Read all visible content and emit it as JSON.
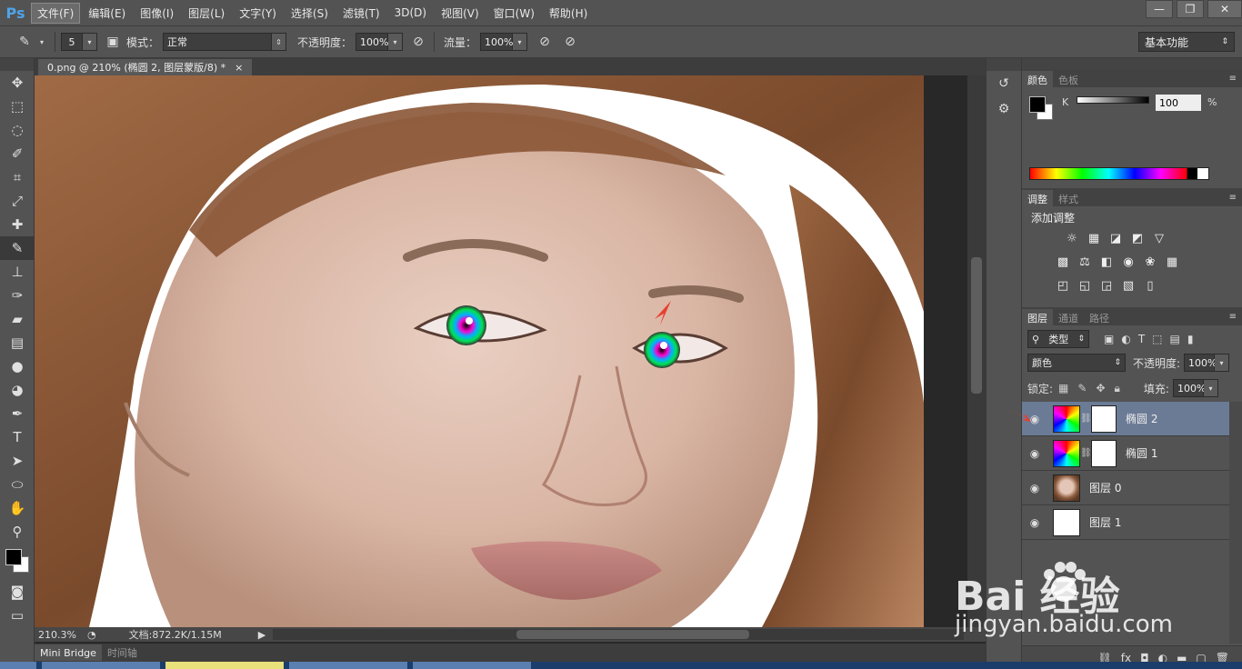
{
  "app": {
    "logo": "Ps",
    "accent": "#4fa3e8"
  },
  "menu": [
    "文件(F)",
    "编辑(E)",
    "图像(I)",
    "图层(L)",
    "文字(Y)",
    "选择(S)",
    "滤镜(T)",
    "3D(D)",
    "视图(V)",
    "窗口(W)",
    "帮助(H)"
  ],
  "window_controls": [
    "—",
    "❐",
    "✕"
  ],
  "options": {
    "brush_size": "5",
    "mode_label": "模式：",
    "mode_value": "正常",
    "opacity_label": "不透明度：",
    "opacity_value": "100%",
    "flow_label": "流量：",
    "flow_value": "100%",
    "workspace": "基本功能"
  },
  "document": {
    "tab_title": "0.png @ 210% (椭圆 2, 图层蒙版/8) *",
    "close": "×",
    "zoom": "210.3%",
    "doc_info": "文档:872.2K/1.15M"
  },
  "bottom_tabs": [
    "Mini Bridge",
    "时间轴"
  ],
  "panels": {
    "color_tabs": [
      "颜色",
      "色板"
    ],
    "k_label": "K",
    "k_value": "100",
    "k_unit": "%",
    "adj_tabs": [
      "调整",
      "样式"
    ],
    "adj_title": "添加调整",
    "layers_tabs": [
      "图层",
      "通道",
      "路径"
    ],
    "filter_kind": "类型",
    "blend_mode": "颜色",
    "opacity_label": "不透明度:",
    "opacity_value": "100%",
    "lock_label": "锁定:",
    "fill_label": "填充:",
    "fill_value": "100%"
  },
  "layers": [
    {
      "name": "椭圆 2",
      "thumb": "color-wheel",
      "mask": true,
      "selected": true
    },
    {
      "name": "椭圆 1",
      "thumb": "color-wheel",
      "mask": true,
      "selected": false
    },
    {
      "name": "图层 0",
      "thumb": "photo",
      "mask": false,
      "selected": false
    },
    {
      "name": "图层 1",
      "thumb": "white",
      "mask": false,
      "selected": false
    }
  ],
  "watermark": {
    "brand": "Bai 经验",
    "url": "jingyan.baidu.com"
  }
}
